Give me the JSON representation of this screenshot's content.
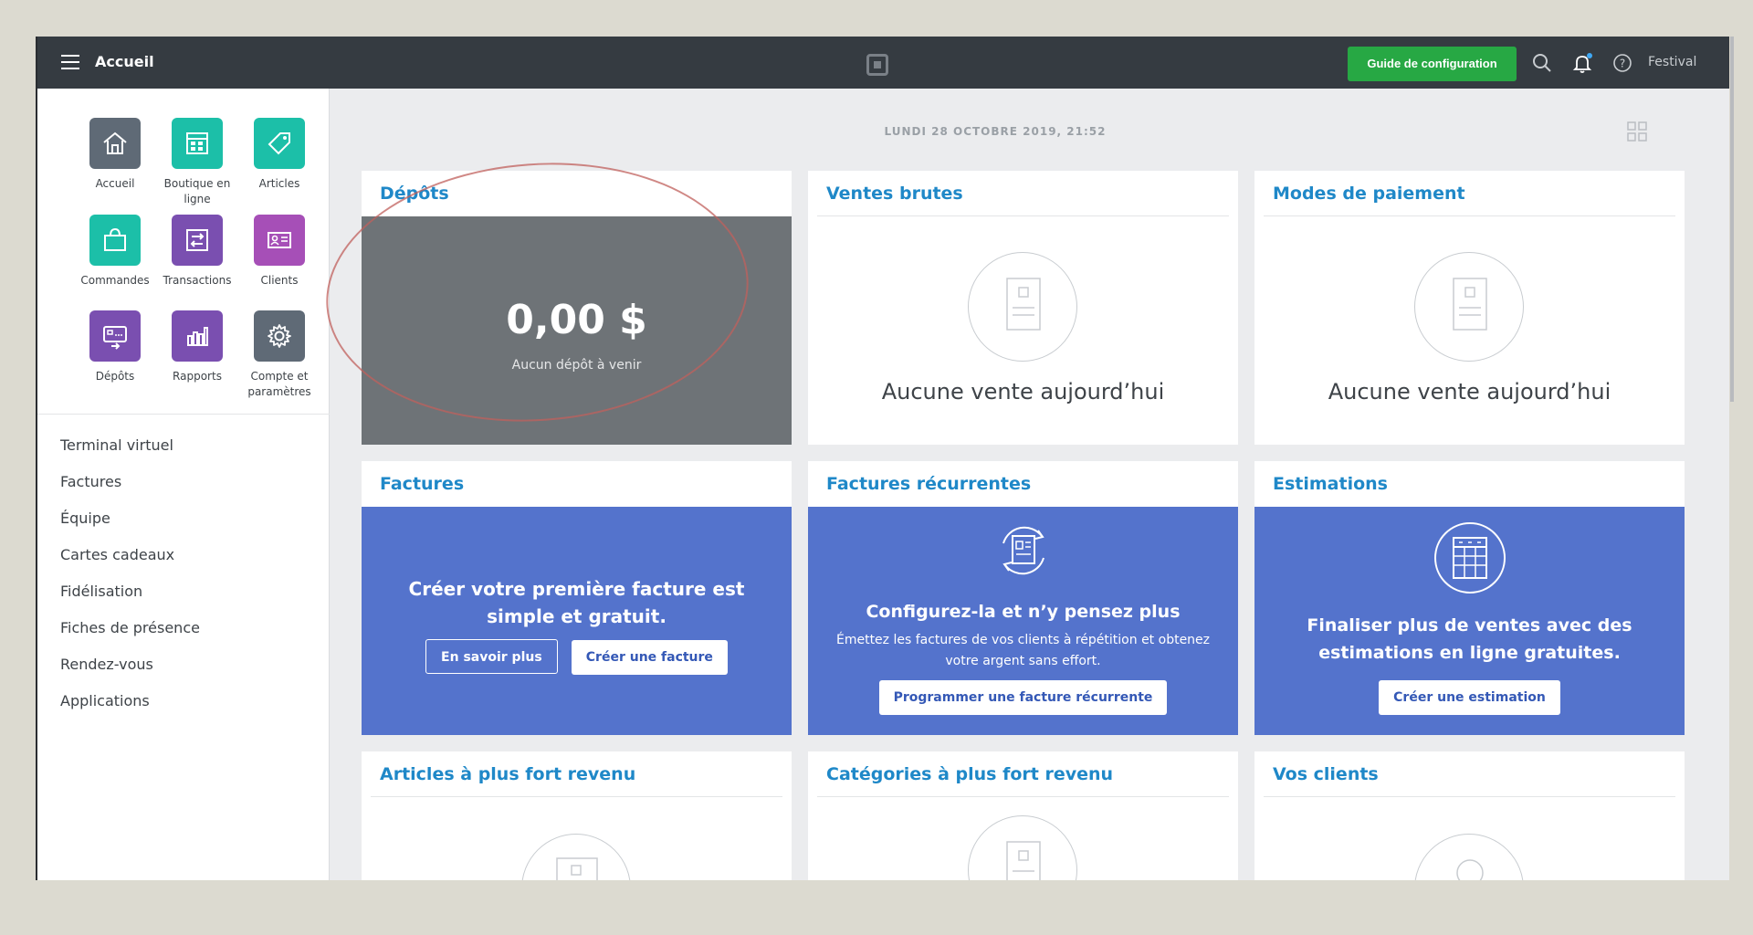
{
  "topbar": {
    "title": "Accueil",
    "guide_label": "Guide de configuration",
    "store_name": "Festival",
    "icons": [
      "menu-icon",
      "square-logo-icon",
      "search-icon",
      "bell-icon",
      "help-icon"
    ],
    "notification_dot_color": "#3fa9f5"
  },
  "sidebar": {
    "tiles": [
      {
        "label": "Accueil",
        "icon": "home-icon",
        "color": "#5f6a76"
      },
      {
        "label": "Boutique en ligne",
        "icon": "storefront-icon",
        "color": "#1cbfa8"
      },
      {
        "label": "Articles",
        "icon": "tag-icon",
        "color": "#1cbfa8"
      },
      {
        "label": "Commandes",
        "icon": "shopping-bag-icon",
        "color": "#1cbfa8"
      },
      {
        "label": "Transactions",
        "icon": "transfer-icon",
        "color": "#7a4fb0"
      },
      {
        "label": "Clients",
        "icon": "contact-card-icon",
        "color": "#a64fb7"
      },
      {
        "label": "Dépôts",
        "icon": "deposit-icon",
        "color": "#7a4fb0"
      },
      {
        "label": "Rapports",
        "icon": "bar-chart-icon",
        "color": "#7a4fb0"
      },
      {
        "label": "Compte et paramètres",
        "icon": "gear-icon",
        "color": "#5f6a76"
      }
    ],
    "links": [
      "Terminal virtuel",
      "Factures",
      "Équipe",
      "Cartes cadeaux",
      "Fidélisation",
      "Fiches de présence",
      "Rendez-vous",
      "Applications"
    ]
  },
  "main": {
    "date": "LUNDI 28 OCTOBRE 2019, 21:52",
    "cards": {
      "depots": {
        "title": "Dépôts",
        "amount": "0,00 $",
        "sub": "Aucun dépôt à venir",
        "bg": "#6e7377"
      },
      "ventes": {
        "title": "Ventes brutes",
        "empty": "Aucune vente aujourd’hui"
      },
      "paiement": {
        "title": "Modes de paiement",
        "empty": "Aucune vente aujourd’hui"
      },
      "factures": {
        "title": "Factures",
        "text": "Créer votre première facture est simple et gratuit.",
        "btn1": "En savoir plus",
        "btn2": "Créer une facture"
      },
      "recurrentes": {
        "title": "Factures récurrentes",
        "heading": "Configurez-la et n’y pensez plus",
        "sub": "Émettez les factures de vos clients à répétition et obtenez votre argent sans effort.",
        "btn": "Programmer une facture récurrente"
      },
      "estimations": {
        "title": "Estimations",
        "text": "Finaliser plus de ventes avec des estimations en ligne gratuites.",
        "btn": "Créer une estimation"
      },
      "articles": {
        "title": "Articles à plus fort revenu"
      },
      "categories": {
        "title": "Catégories à plus fort revenu"
      },
      "clients": {
        "title": "Vos clients"
      }
    },
    "accent_blue": "#1f88c8",
    "promo_blue": "#5473cc",
    "annotation_color": "#c0605c"
  }
}
